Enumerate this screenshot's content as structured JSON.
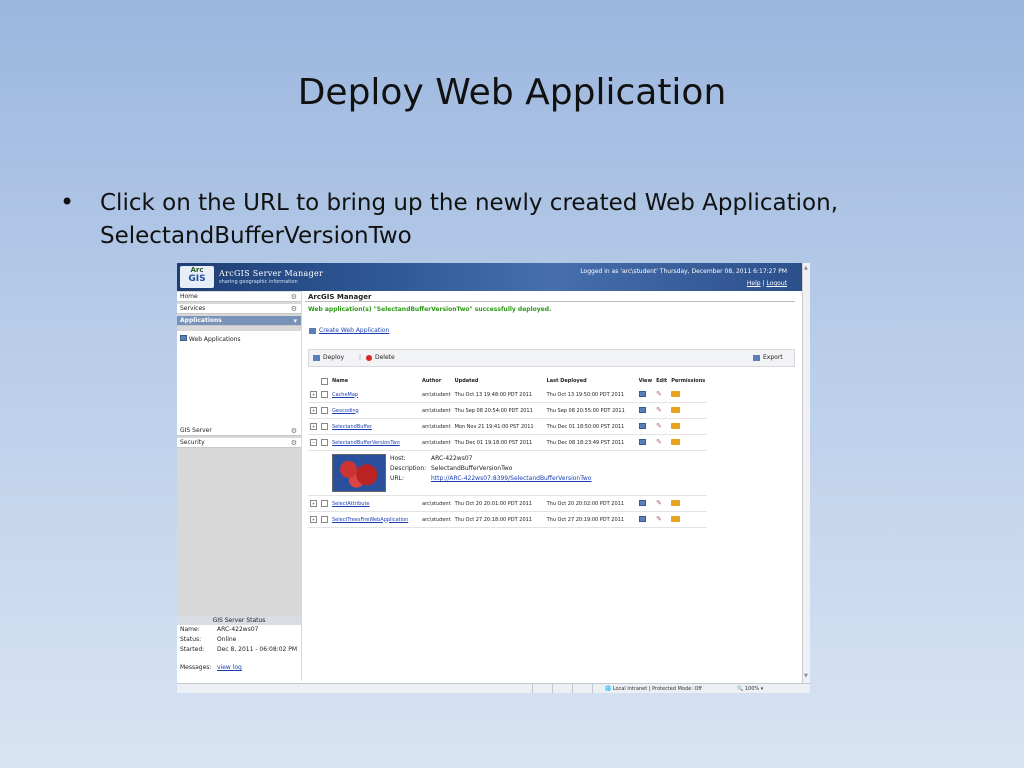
{
  "slide": {
    "title": "Deploy Web Application",
    "bullet": "Click on the URL to bring up the newly created Web Application, SelectandBufferVersionTwo"
  },
  "banner": {
    "logo_top": "Arc",
    "logo_bottom": "GIS",
    "title": "ArcGIS Server Manager",
    "subtitle": "sharing geographic information",
    "login_info": "Logged in as 'arc\\student'   Thursday, December 08, 2011 6:17:27 PM",
    "help": "Help",
    "logout": "Logout"
  },
  "sidebar": {
    "nav": [
      {
        "label": "Home"
      },
      {
        "label": "Services"
      },
      {
        "label": "Applications"
      }
    ],
    "sub_item": "Web Applications",
    "nav_bottom": [
      {
        "label": "GIS Server"
      },
      {
        "label": "Security"
      }
    ],
    "status": {
      "heading": "GIS Server Status",
      "name_label": "Name:",
      "name_value": "ARC-422ws07",
      "status_label": "Status:",
      "status_value": "Online",
      "started_label": "Started:",
      "started_value": "Dec 8, 2011 - 06:08:02 PM",
      "messages_label": "Messages:",
      "messages_value": "view log"
    }
  },
  "main": {
    "breadcrumb": "ArcGIS Manager",
    "success": "Web application(s) \"SelectandBufferVersionTwo\" successfully deployed.",
    "create_link": "Create Web Application",
    "toolbar": {
      "deploy": "Deploy",
      "delete": "Delete",
      "export": "Export"
    },
    "columns": [
      "Name",
      "Author",
      "Updated",
      "Last Deployed",
      "View",
      "Edit",
      "Permissions"
    ],
    "rows": [
      {
        "expander": "+",
        "name": "CacheMap",
        "author": "arc\\student",
        "updated": "Thu Oct 13 19:48:00 PDT 2011",
        "deployed": "Thu Oct 13 19:50:00 PDT 2011"
      },
      {
        "expander": "+",
        "name": "Geocoding",
        "author": "arc\\student",
        "updated": "Thu Sep 08 20:54:00 PDT 2011",
        "deployed": "Thu Sep 08 20:55:00 PDT 2011"
      },
      {
        "expander": "+",
        "name": "SelectandBuffer",
        "author": "arc\\student",
        "updated": "Mon Nov 21 19:41:00 PST 2011",
        "deployed": "Thu Dec 01 18:50:00 PST 2011"
      },
      {
        "expander": "−",
        "name": "SelectandBufferVersionTwo",
        "author": "arc\\student",
        "updated": "Thu Dec 01 19:18:00 PST 2011",
        "deployed": "Thu Dec 08 18:23:49 PST 2011"
      },
      {
        "expander": "+",
        "name": "SelectAttribute",
        "author": "arc\\student",
        "updated": "Thu Oct 20 20:01:00 PDT 2011",
        "deployed": "Thu Oct 20 20:02:00 PDT 2011"
      },
      {
        "expander": "+",
        "name": "SelectTreesFireWebApplication",
        "author": "arc\\student",
        "updated": "Thu Oct 27 20:18:00 PDT 2011",
        "deployed": "Thu Oct 27 20:19:00 PDT 2011"
      }
    ],
    "detail": {
      "host_label": "Host:",
      "host_value": "ARC-422ws07",
      "desc_label": "Description:",
      "desc_value": "SelectandBufferVersionTwo",
      "url_label": "URL:",
      "url_value": "http://ARC-422ws07:8399/SelectandBufferVersionTwo"
    }
  },
  "statusbar": {
    "zone": "Local intranet | Protected Mode: Off",
    "zoom": "100%"
  },
  "colors": {
    "banner": "#2f5a98",
    "success": "#2b9a15",
    "link": "#1b3fb0",
    "active_nav": "#7892b8"
  }
}
